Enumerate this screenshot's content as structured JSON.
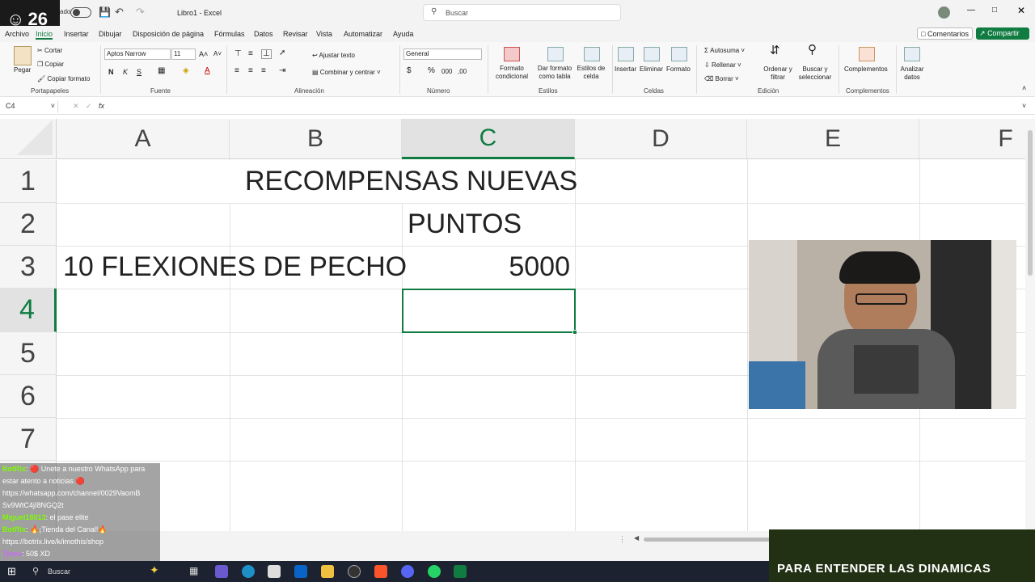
{
  "overlay": {
    "viewer_count": "26",
    "autosave_label": "ado"
  },
  "titlebar": {
    "doc_title": "Libro1 - Excel",
    "search_placeholder": "Buscar"
  },
  "tabs": [
    "Archivo",
    "Inicio",
    "Insertar",
    "Dibujar",
    "Disposición de página",
    "Fórmulas",
    "Datos",
    "Revisar",
    "Vista",
    "Automatizar",
    "Ayuda"
  ],
  "header_buttons": {
    "comments": "Comentarios",
    "share": "Compartir"
  },
  "ribbon": {
    "clipboard": {
      "paste": "Pegar",
      "cut": "Cortar",
      "copy": "Copiar",
      "format_painter": "Copiar formato",
      "label": "Portapapeles"
    },
    "font": {
      "name": "Aptos Narrow",
      "size": "11",
      "label": "Fuente",
      "bold": "N",
      "italic": "K",
      "underline": "S"
    },
    "alignment": {
      "wrap": "Ajustar texto",
      "merge": "Combinar y centrar",
      "label": "Alineación"
    },
    "number": {
      "format": "General",
      "label": "Número"
    },
    "styles": {
      "conditional": "Formato condicional",
      "table": "Dar formato como tabla",
      "cell_styles": "Estilos de celda",
      "label": "Estilos"
    },
    "cells": {
      "insert": "Insertar",
      "delete": "Eliminar",
      "format": "Formato",
      "label": "Celdas"
    },
    "editing": {
      "autosum": "Autosuma",
      "fill": "Rellenar",
      "clear": "Borrar",
      "sort": "Ordenar y filtrar",
      "find": "Buscar y seleccionar",
      "label": "Edición"
    },
    "addins": {
      "complements": "Complementos",
      "label": "Complementos"
    },
    "analyze": {
      "label": "Analizar datos"
    }
  },
  "formula_bar": {
    "cell_ref": "C4",
    "fx": "fx",
    "value": ""
  },
  "columns": [
    "A",
    "B",
    "C",
    "D",
    "E",
    "F"
  ],
  "rows": [
    "1",
    "2",
    "3",
    "4",
    "5",
    "6",
    "7"
  ],
  "cells": {
    "B1": "RECOMPENSAS NUEVAS",
    "C2": "PUNTOS",
    "A3": "10 FLEXIONES DE PECHO",
    "C3": "5000"
  },
  "selected_cell": "C4",
  "chat": [
    {
      "user": "BotRix",
      "text": ": 🔴 Unete a nuestro WhatsApp para estar atento a noticias 🔴 https://whatsapp.com/channel/0029VaomB Sv9WtC4jI8NGQ2t"
    },
    {
      "user": "Miguel18013",
      "text": ": el pase elite"
    },
    {
      "user": "BotRix",
      "text": ": 🔥¡Tienda del Canal!🔥 https://botrix.live/k/imothis/shop"
    },
    {
      "user": "Tjosu",
      "text": ": 50$ XD"
    }
  ],
  "taskbar": {
    "search": "Buscar"
  },
  "banner": {
    "text": "PARA ENTENDER LAS DINAMICAS"
  },
  "colors": {
    "excel_green": "#107c41",
    "selection": "#217346"
  }
}
